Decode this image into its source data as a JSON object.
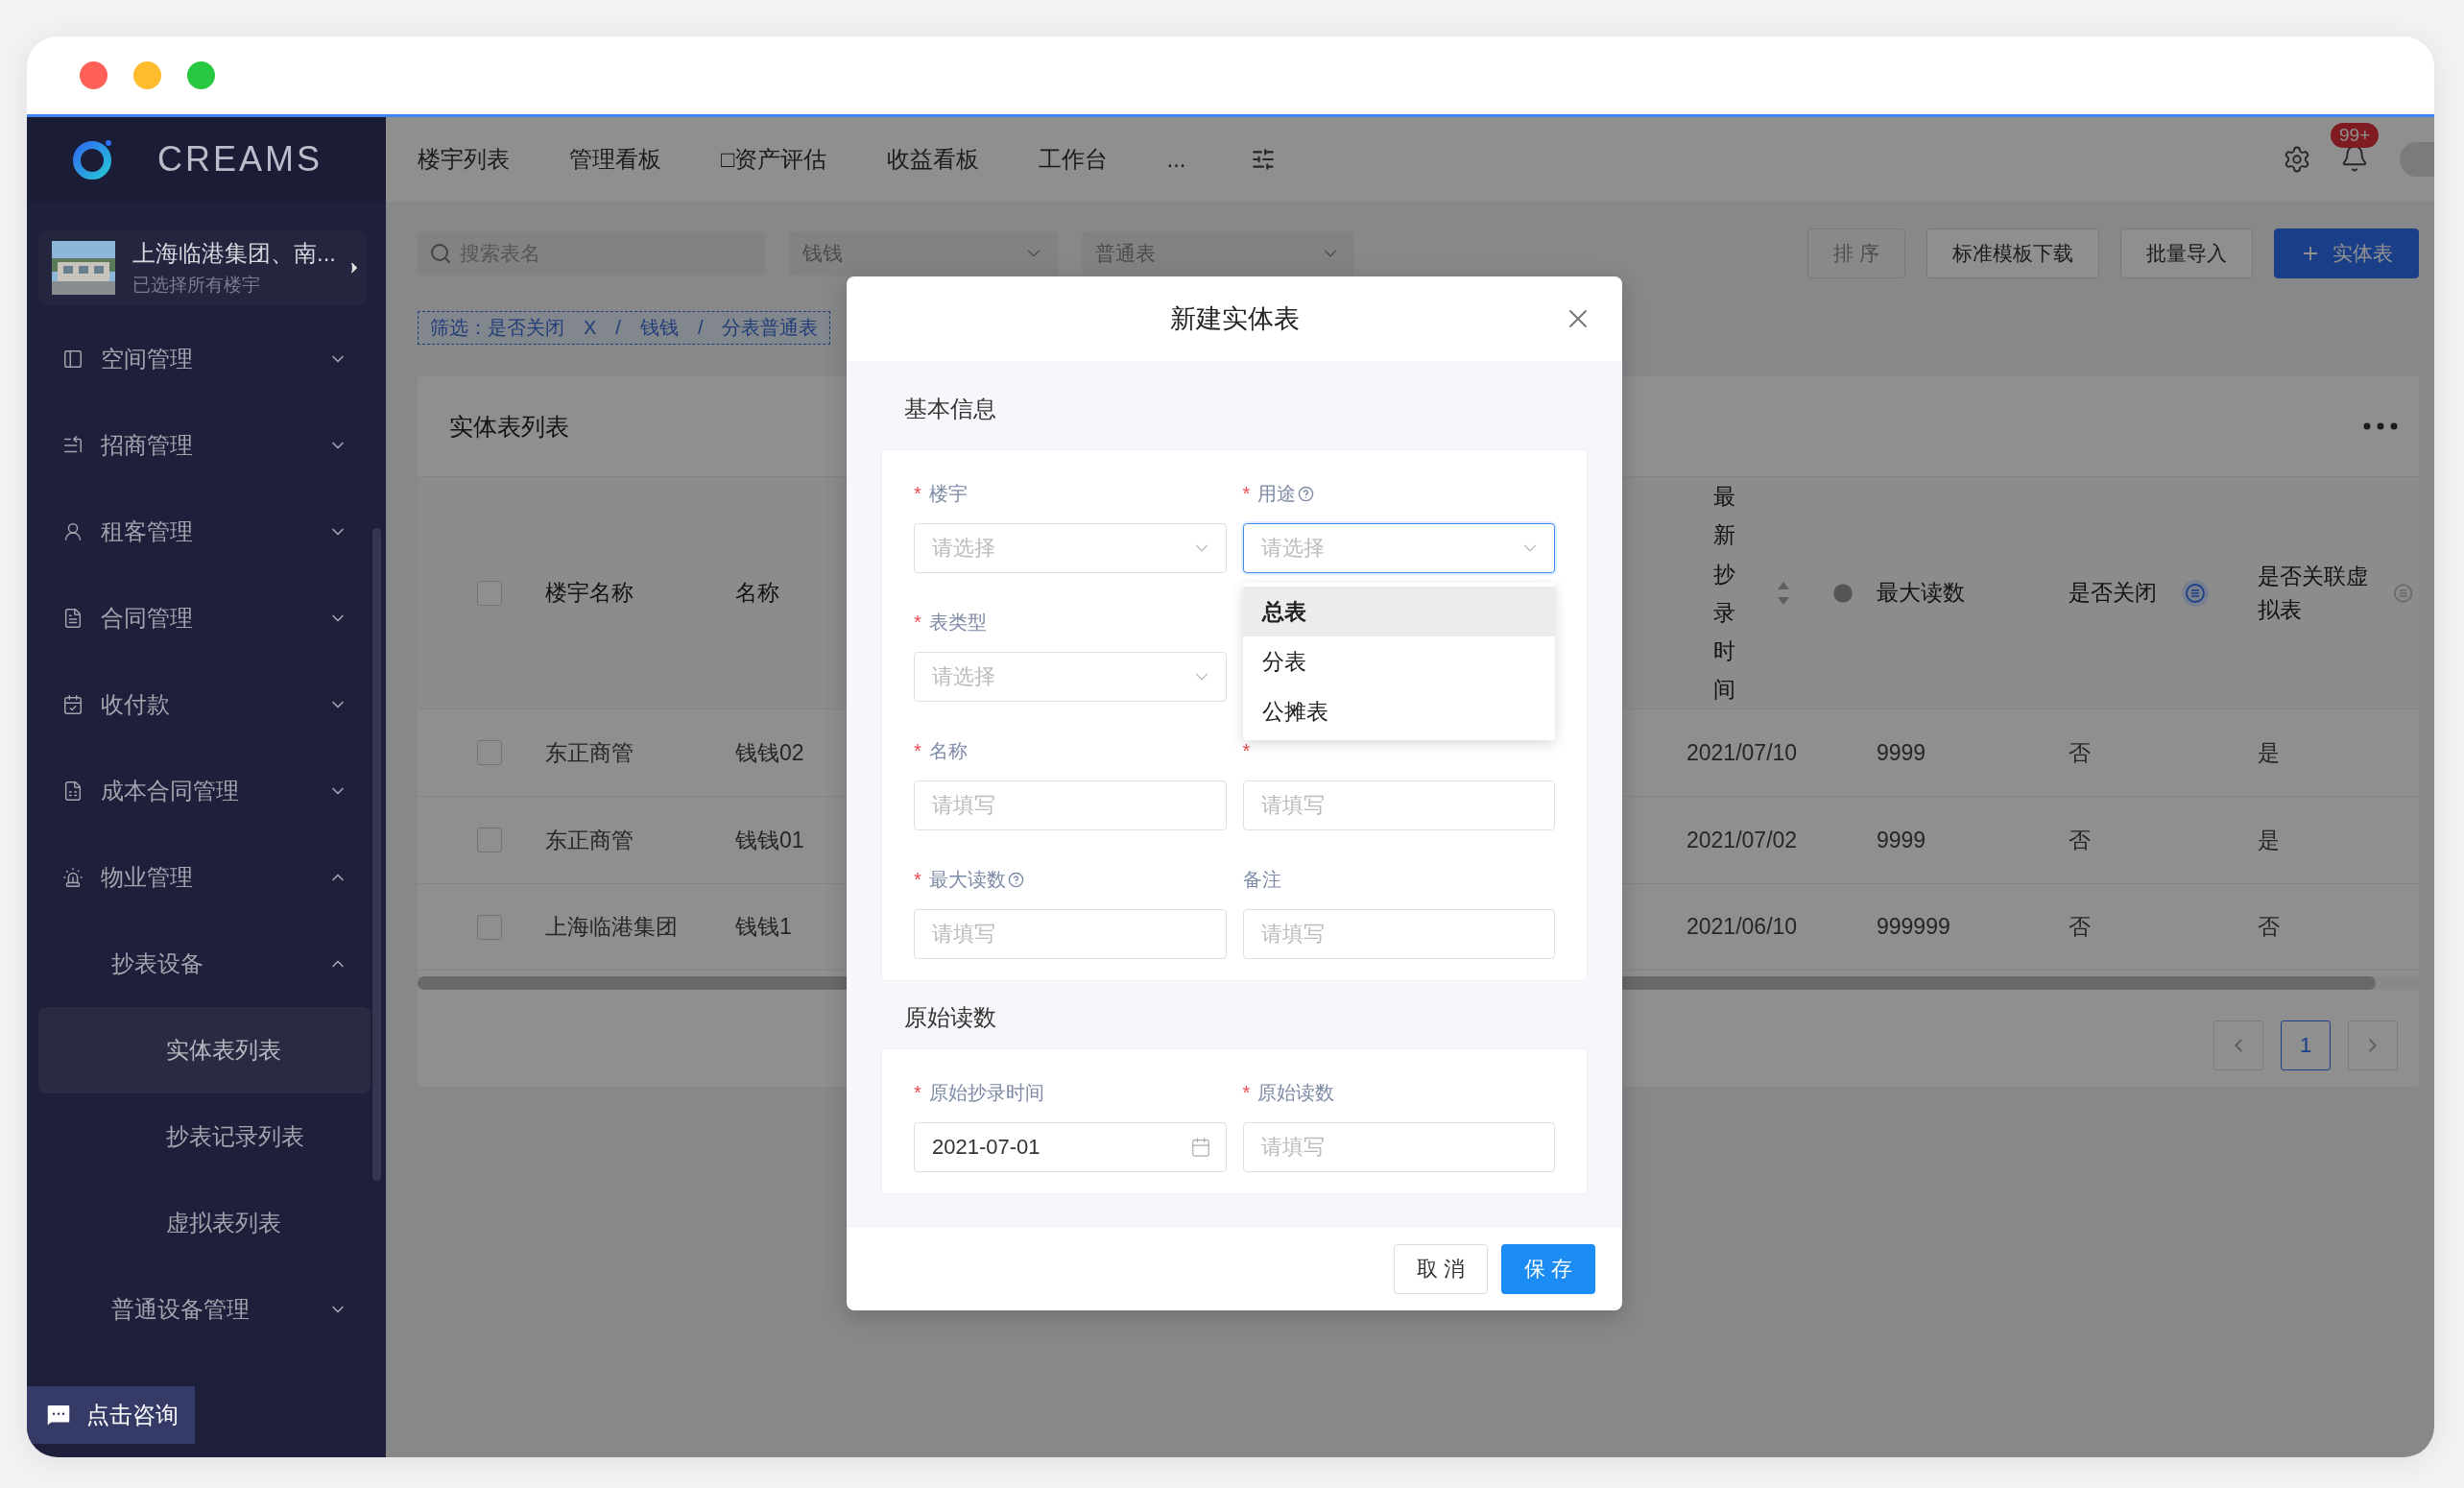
{
  "app": {
    "logo": "CREAMS"
  },
  "project": {
    "name": "上海临港集团、南...",
    "subtitle": "已选择所有楼宇"
  },
  "sidebar": {
    "items": [
      {
        "label": "空间管理",
        "expanded": false
      },
      {
        "label": "招商管理",
        "expanded": false
      },
      {
        "label": "租客管理",
        "expanded": false
      },
      {
        "label": "合同管理",
        "expanded": false
      },
      {
        "label": "收付款",
        "expanded": false
      },
      {
        "label": "成本合同管理",
        "expanded": false
      },
      {
        "label": "物业管理",
        "expanded": true,
        "children": [
          {
            "label": "抄表设备",
            "expanded": true,
            "children": [
              {
                "label": "实体表列表",
                "selected": true
              },
              {
                "label": "抄表记录列表",
                "selected": false
              },
              {
                "label": "虚拟表列表",
                "selected": false
              }
            ]
          },
          {
            "label": "普通设备管理",
            "expanded": false
          }
        ]
      }
    ]
  },
  "consult_button": "点击咨询",
  "top_nav": {
    "items": [
      "楼宇列表",
      "管理看板",
      "□资产评估",
      "收益看板",
      "工作台",
      "..."
    ]
  },
  "notifications": {
    "badge": "99+"
  },
  "filters": {
    "search_placeholder": "搜索表名",
    "selects": [
      "钱钱",
      "普通表"
    ]
  },
  "actions": [
    {
      "label": "排 序",
      "kind": "default",
      "disabled": true
    },
    {
      "label": "标准模板下载",
      "kind": "default",
      "disabled": false
    },
    {
      "label": "批量导入",
      "kind": "default",
      "disabled": false
    },
    {
      "label": "实体表",
      "kind": "primary",
      "disabled": false
    }
  ],
  "active_filters": "筛选：是否关闭　X　/　钱钱　/　分表普通表",
  "table": {
    "title": "实体表列表",
    "header_checked": false,
    "columns": [
      {
        "label": "楼宇名称"
      },
      {
        "label": "名称"
      },
      {
        "label": "最新抄录时间",
        "sortable": true
      },
      {
        "label": "最大读数"
      },
      {
        "label": "是否关闭",
        "filter_active": true
      },
      {
        "label": "是否关联虚拟表",
        "filter_active": false
      }
    ],
    "rows": [
      {
        "checked": false,
        "cells": [
          "东正商管",
          "钱钱02",
          "2021/07/10",
          "9999",
          "否",
          "是"
        ]
      },
      {
        "checked": false,
        "cells": [
          "东正商管",
          "钱钱01",
          "2021/07/02",
          "9999",
          "否",
          "是"
        ]
      },
      {
        "checked": false,
        "cells": [
          "上海临港集团",
          "钱钱1",
          "2021/06/10",
          "999999",
          "否",
          "否"
        ]
      }
    ]
  },
  "pagination": {
    "pages": [
      {
        "label": "1",
        "selected": true
      }
    ]
  },
  "modal": {
    "title": "新建实体表",
    "sections": [
      {
        "title": "基本信息",
        "rows": [
          [
            {
              "label": "楼宇",
              "required_mark": "*",
              "kind": "select",
              "placeholder": "请选择",
              "focused": false
            },
            {
              "label": "用途",
              "required_mark": "*",
              "help": true,
              "kind": "select",
              "placeholder": "请选择",
              "focused": true,
              "options": [
                {
                  "label": "总表",
                  "highlighted": true
                },
                {
                  "label": "分表",
                  "highlighted": false
                },
                {
                  "label": "公摊表",
                  "highlighted": false
                }
              ]
            }
          ],
          [
            {
              "label": "表类型",
              "required_mark": "*",
              "kind": "select",
              "placeholder": "请选择",
              "focused": false
            }
          ],
          [
            {
              "label": "名称",
              "required_mark": "*",
              "kind": "text",
              "placeholder": "请填写",
              "focused": false
            },
            {
              "required_mark": "*",
              "kind": "text",
              "placeholder": "请填写",
              "focused": false
            }
          ],
          [
            {
              "label": "最大读数",
              "required_mark": "*",
              "help": true,
              "kind": "text",
              "placeholder": "请填写",
              "focused": false
            },
            {
              "label": "备注",
              "kind": "text",
              "placeholder": "请填写",
              "focused": false
            }
          ]
        ]
      },
      {
        "title": "原始读数",
        "rows": [
          [
            {
              "label": "原始抄录时间",
              "required_mark": "*",
              "kind": "date",
              "value": "2021-07-01",
              "focused": false
            },
            {
              "label": "原始读数",
              "required_mark": "*",
              "kind": "text",
              "placeholder": "请填写",
              "focused": false
            }
          ]
        ]
      }
    ],
    "buttons": [
      {
        "label": "取 消",
        "kind": "default"
      },
      {
        "label": "保 存",
        "kind": "primary"
      }
    ]
  }
}
